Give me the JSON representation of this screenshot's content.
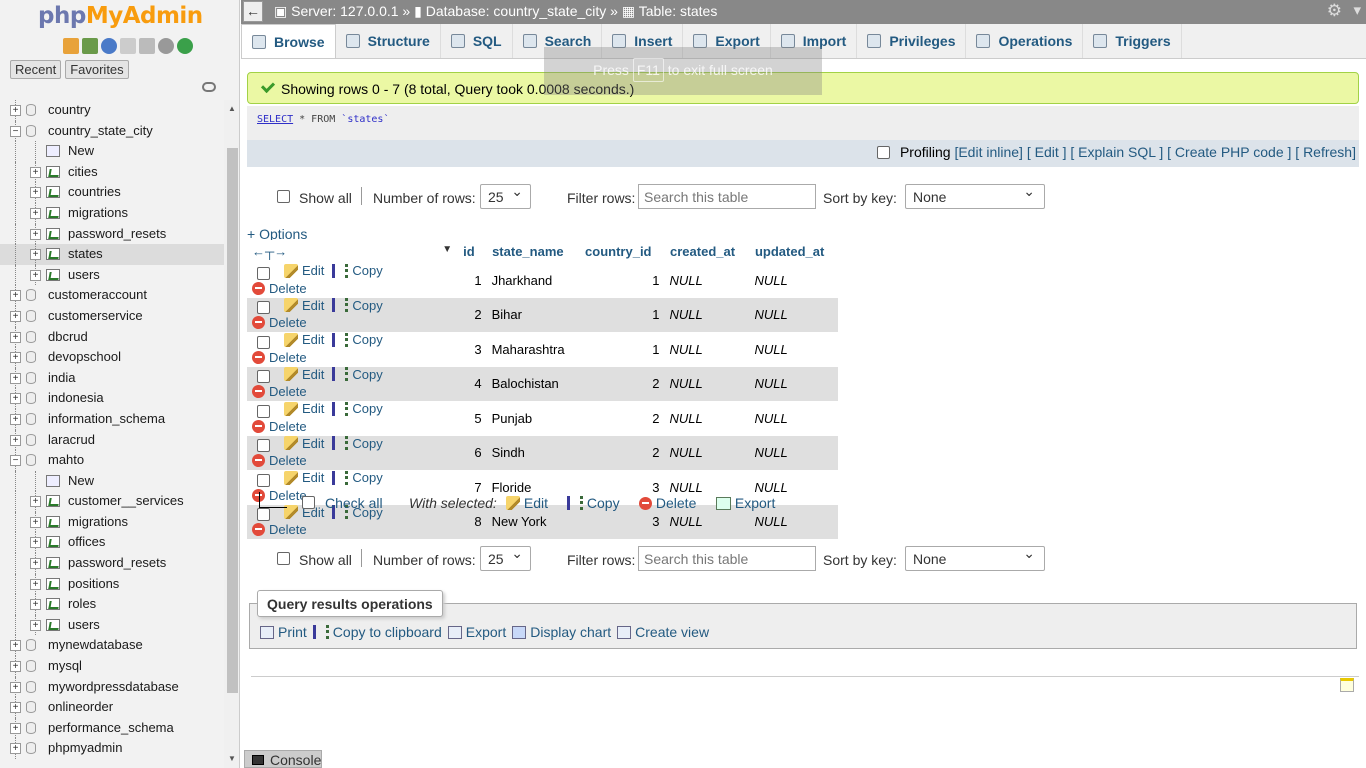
{
  "app": {
    "logo_php": "php",
    "logo_myadmin": "MyAdmin"
  },
  "sidebar": {
    "nav_tabs": [
      "Recent",
      "Favorites"
    ],
    "tree": [
      {
        "label": "country",
        "level": 0,
        "kind": "db",
        "exp": "+"
      },
      {
        "label": "country_state_city",
        "level": 0,
        "kind": "db",
        "exp": "−"
      },
      {
        "label": "New",
        "level": 1,
        "kind": "new"
      },
      {
        "label": "cities",
        "level": 1,
        "kind": "table",
        "exp": "+"
      },
      {
        "label": "countries",
        "level": 1,
        "kind": "table",
        "exp": "+"
      },
      {
        "label": "migrations",
        "level": 1,
        "kind": "table",
        "exp": "+"
      },
      {
        "label": "password_resets",
        "level": 1,
        "kind": "table",
        "exp": "+"
      },
      {
        "label": "states",
        "level": 1,
        "kind": "table",
        "exp": "+",
        "selected": true
      },
      {
        "label": "users",
        "level": 1,
        "kind": "table",
        "exp": "+"
      },
      {
        "label": "customeraccount",
        "level": 0,
        "kind": "db",
        "exp": "+"
      },
      {
        "label": "customerservice",
        "level": 0,
        "kind": "db",
        "exp": "+"
      },
      {
        "label": "dbcrud",
        "level": 0,
        "kind": "db",
        "exp": "+"
      },
      {
        "label": "devopschool",
        "level": 0,
        "kind": "db",
        "exp": "+"
      },
      {
        "label": "india",
        "level": 0,
        "kind": "db",
        "exp": "+"
      },
      {
        "label": "indonesia",
        "level": 0,
        "kind": "db",
        "exp": "+"
      },
      {
        "label": "information_schema",
        "level": 0,
        "kind": "db",
        "exp": "+"
      },
      {
        "label": "laracrud",
        "level": 0,
        "kind": "db",
        "exp": "+"
      },
      {
        "label": "mahto",
        "level": 0,
        "kind": "db",
        "exp": "−"
      },
      {
        "label": "New",
        "level": 1,
        "kind": "new"
      },
      {
        "label": "customer__services",
        "level": 1,
        "kind": "table",
        "exp": "+"
      },
      {
        "label": "migrations",
        "level": 1,
        "kind": "table",
        "exp": "+"
      },
      {
        "label": "offices",
        "level": 1,
        "kind": "table",
        "exp": "+"
      },
      {
        "label": "password_resets",
        "level": 1,
        "kind": "table",
        "exp": "+"
      },
      {
        "label": "positions",
        "level": 1,
        "kind": "table",
        "exp": "+"
      },
      {
        "label": "roles",
        "level": 1,
        "kind": "table",
        "exp": "+"
      },
      {
        "label": "users",
        "level": 1,
        "kind": "table",
        "exp": "+"
      },
      {
        "label": "mynewdatabase",
        "level": 0,
        "kind": "db",
        "exp": "+"
      },
      {
        "label": "mysql",
        "level": 0,
        "kind": "db",
        "exp": "+"
      },
      {
        "label": "mywordpressdatabase",
        "level": 0,
        "kind": "db",
        "exp": "+"
      },
      {
        "label": "onlineorder",
        "level": 0,
        "kind": "db",
        "exp": "+"
      },
      {
        "label": "performance_schema",
        "level": 0,
        "kind": "db",
        "exp": "+"
      },
      {
        "label": "phpmyadmin",
        "level": 0,
        "kind": "db",
        "exp": "+"
      }
    ]
  },
  "breadcrumb": {
    "server": "Server: 127.0.0.1",
    "sep1": "»",
    "database": "Database: country_state_city",
    "sep2": "»",
    "table": "Table: states"
  },
  "menu_tabs": [
    "Browse",
    "Structure",
    "SQL",
    "Search",
    "Insert",
    "Export",
    "Import",
    "Privileges",
    "Operations",
    "Triggers"
  ],
  "fullscreen_notice": {
    "pre": "Press",
    "key": "F11",
    "post": "to exit full screen"
  },
  "success_message": "Showing rows 0 - 7 (8 total, Query took 0.0008 seconds.)",
  "sql": {
    "kw1": "SELECT",
    "rest": " * FROM ",
    "tbl": "`states`"
  },
  "profiling": {
    "label": "Profiling",
    "links": [
      "[Edit inline]",
      "[ Edit ]",
      "[ Explain SQL ]",
      "[ Create PHP code ]",
      "[ Refresh]"
    ]
  },
  "navigation": {
    "show_all": "Show all",
    "rows_label": "Number of rows:",
    "rows_value": "25",
    "filter_label": "Filter rows:",
    "filter_placeholder": "Search this table",
    "sort_label": "Sort by key:",
    "sort_value": "None"
  },
  "options_link": "+ Options",
  "table": {
    "columns": [
      "id",
      "state_name",
      "country_id",
      "created_at",
      "updated_at"
    ],
    "actions": {
      "edit": "Edit",
      "copy": "Copy",
      "delete": "Delete"
    },
    "rows": [
      {
        "id": "1",
        "state_name": "Jharkhand",
        "country_id": "1",
        "created_at": "NULL",
        "updated_at": "NULL"
      },
      {
        "id": "2",
        "state_name": "Bihar",
        "country_id": "1",
        "created_at": "NULL",
        "updated_at": "NULL"
      },
      {
        "id": "3",
        "state_name": "Maharashtra",
        "country_id": "1",
        "created_at": "NULL",
        "updated_at": "NULL"
      },
      {
        "id": "4",
        "state_name": "Balochistan",
        "country_id": "2",
        "created_at": "NULL",
        "updated_at": "NULL"
      },
      {
        "id": "5",
        "state_name": "Punjab",
        "country_id": "2",
        "created_at": "NULL",
        "updated_at": "NULL"
      },
      {
        "id": "6",
        "state_name": "Sindh",
        "country_id": "2",
        "created_at": "NULL",
        "updated_at": "NULL"
      },
      {
        "id": "7",
        "state_name": "Floride",
        "country_id": "3",
        "created_at": "NULL",
        "updated_at": "NULL"
      },
      {
        "id": "8",
        "state_name": "New York",
        "country_id": "3",
        "created_at": "NULL",
        "updated_at": "NULL"
      }
    ]
  },
  "with_selected": {
    "check_all": "Check all",
    "label": "With selected:",
    "edit": "Edit",
    "copy": "Copy",
    "delete": "Delete",
    "export": "Export"
  },
  "query_ops": {
    "legend": "Query results operations",
    "print": "Print",
    "copy": "Copy to clipboard",
    "export": "Export",
    "chart": "Display chart",
    "view": "Create view"
  },
  "console": "Console",
  "colors": {
    "link": "#235a81",
    "success_bg": "#ebf8a4",
    "topbar": "#888888"
  }
}
